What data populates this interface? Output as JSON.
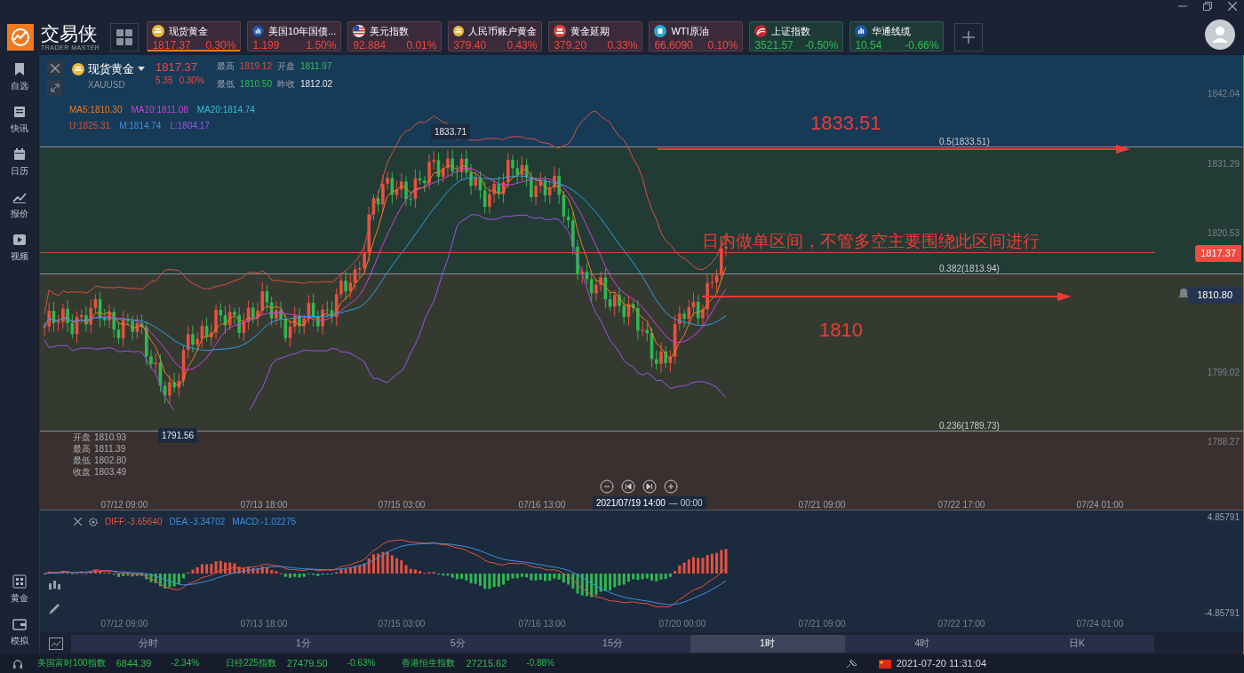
{
  "app": {
    "name": "交易侠",
    "subtitle": "TRADER MASTER"
  },
  "quotes": [
    {
      "name": "现货黄金",
      "price": "1817.37",
      "change": "0.30%",
      "color": "#f0493e",
      "selected": true
    },
    {
      "name": "美国10年国债...",
      "price": "1.199",
      "change": "1.50%",
      "color": "#f0493e",
      "selected": false
    },
    {
      "name": "美元指数",
      "price": "92.884",
      "change": "0.01%",
      "color": "#f0493e",
      "selected": false
    },
    {
      "name": "人民币账户黄金",
      "price": "379.40",
      "change": "0.43%",
      "color": "#f0493e",
      "selected": false
    },
    {
      "name": "黄金延期",
      "price": "379.20",
      "change": "0.33%",
      "color": "#f0493e",
      "selected": false
    },
    {
      "name": "WTI原油",
      "price": "66.6090",
      "change": "0.10%",
      "color": "#f0493e",
      "selected": false
    },
    {
      "name": "上证指数",
      "price": "3521.57",
      "change": "-0.50%",
      "color": "#2ebd4f",
      "selected": false
    },
    {
      "name": "华通线缆",
      "price": "10.54",
      "change": "-0.66%",
      "color": "#2ebd4f",
      "selected": false
    }
  ],
  "sidebar": {
    "top": [
      "自选",
      "快讯",
      "日历",
      "报价",
      "视频"
    ],
    "bottom": [
      "黄金",
      "模拟"
    ]
  },
  "instrument": {
    "name": "现货黄金",
    "symbol": "XAUUSD",
    "price": "1817.37",
    "change": "5.35",
    "change_pct": "0.30%",
    "stats": [
      {
        "label": "最高",
        "value": "1819.12",
        "color": "#f0493e"
      },
      {
        "label": "开盘",
        "value": "1811.97",
        "color": "#2ebd4f"
      },
      {
        "label": "最低",
        "value": "1810.50",
        "color": "#2ebd4f"
      },
      {
        "label": "昨收",
        "value": "1812.02",
        "color": "#e6e8ec"
      }
    ]
  },
  "indicators": [
    [
      {
        "text": "MA5:1810.30",
        "color": "#f07a22"
      },
      {
        "text": "MA10:1811.08",
        "color": "#d23fd8"
      },
      {
        "text": "MA20:1814.74",
        "color": "#2fc1d1"
      }
    ],
    [
      {
        "text": "U:1825.31",
        "color": "#d9503e"
      },
      {
        "text": "M:1814.74",
        "color": "#3f8fe6"
      },
      {
        "text": "L:1804.17",
        "color": "#9a55e6"
      }
    ]
  ],
  "chart": {
    "y_ticks": [
      "1842.04",
      "1831.29",
      "1820.53",
      "1799.02",
      "1788.27"
    ],
    "x_ticks": [
      "07/12 09:00",
      "07/13 18:00",
      "07/15 03:00",
      "07/16 13:00",
      "07/21 09:00",
      "07/22 17:00",
      "07/24 01:00"
    ],
    "high_label": "1833.71",
    "low_label": "1791.56",
    "ohlc": [
      {
        "label": "开盘",
        "value": "1810.93"
      },
      {
        "label": "最高",
        "value": "1811.39"
      },
      {
        "label": "最低",
        "value": "1802.80"
      },
      {
        "label": "收盘",
        "value": "1803.49"
      }
    ],
    "current_price": "1817.37",
    "alert_price": "1810.80",
    "fib_levels": [
      "0.5(1833.51)",
      "0.382(1813.94)",
      "0.236(1789.73)"
    ],
    "annotations": [
      "1833.51",
      "日内做单区间，不管多空主要围绕此区间进行",
      "1810"
    ],
    "cursor_time": "2021/07/19 14:00",
    "cursor_suffix": "— 00:00"
  },
  "macd": {
    "labels": [
      {
        "text": "DIFF:-3.65640",
        "color": "#e8503f"
      },
      {
        "text": "DEA:-3.34702",
        "color": "#3f8fe6"
      },
      {
        "text": "MACD:-1.02275",
        "color": "#3f8fe6"
      }
    ],
    "y_ticks": [
      "4.85791",
      "-4.85791"
    ],
    "x_ticks": [
      "07/12 09:00",
      "07/13 18:00",
      "07/15 03:00",
      "07/16 13:00",
      "07/20 00:00",
      "07/21 09:00",
      "07/22 17:00",
      "07/24 01:00"
    ]
  },
  "timeframes": [
    {
      "label": "分时",
      "selected": false
    },
    {
      "label": "1分",
      "selected": false
    },
    {
      "label": "5分",
      "selected": false
    },
    {
      "label": "15分",
      "selected": false
    },
    {
      "label": "1时",
      "selected": true
    },
    {
      "label": "4时",
      "selected": false
    },
    {
      "label": "日K",
      "selected": false
    }
  ],
  "status_bar": {
    "tickers": [
      {
        "name": "美国富时100指数",
        "value": "6844.39",
        "change": "-2.34%",
        "color": "#2ebd4f"
      },
      {
        "name": "日经225指数",
        "value": "27479.50",
        "change": "-0.63%",
        "color": "#2ebd4f"
      },
      {
        "name": "香港恒生指数",
        "value": "27215.62",
        "change": "-0.88%",
        "color": "#2ebd4f"
      }
    ],
    "datetime": "2021-07-20 11:31:04"
  }
}
